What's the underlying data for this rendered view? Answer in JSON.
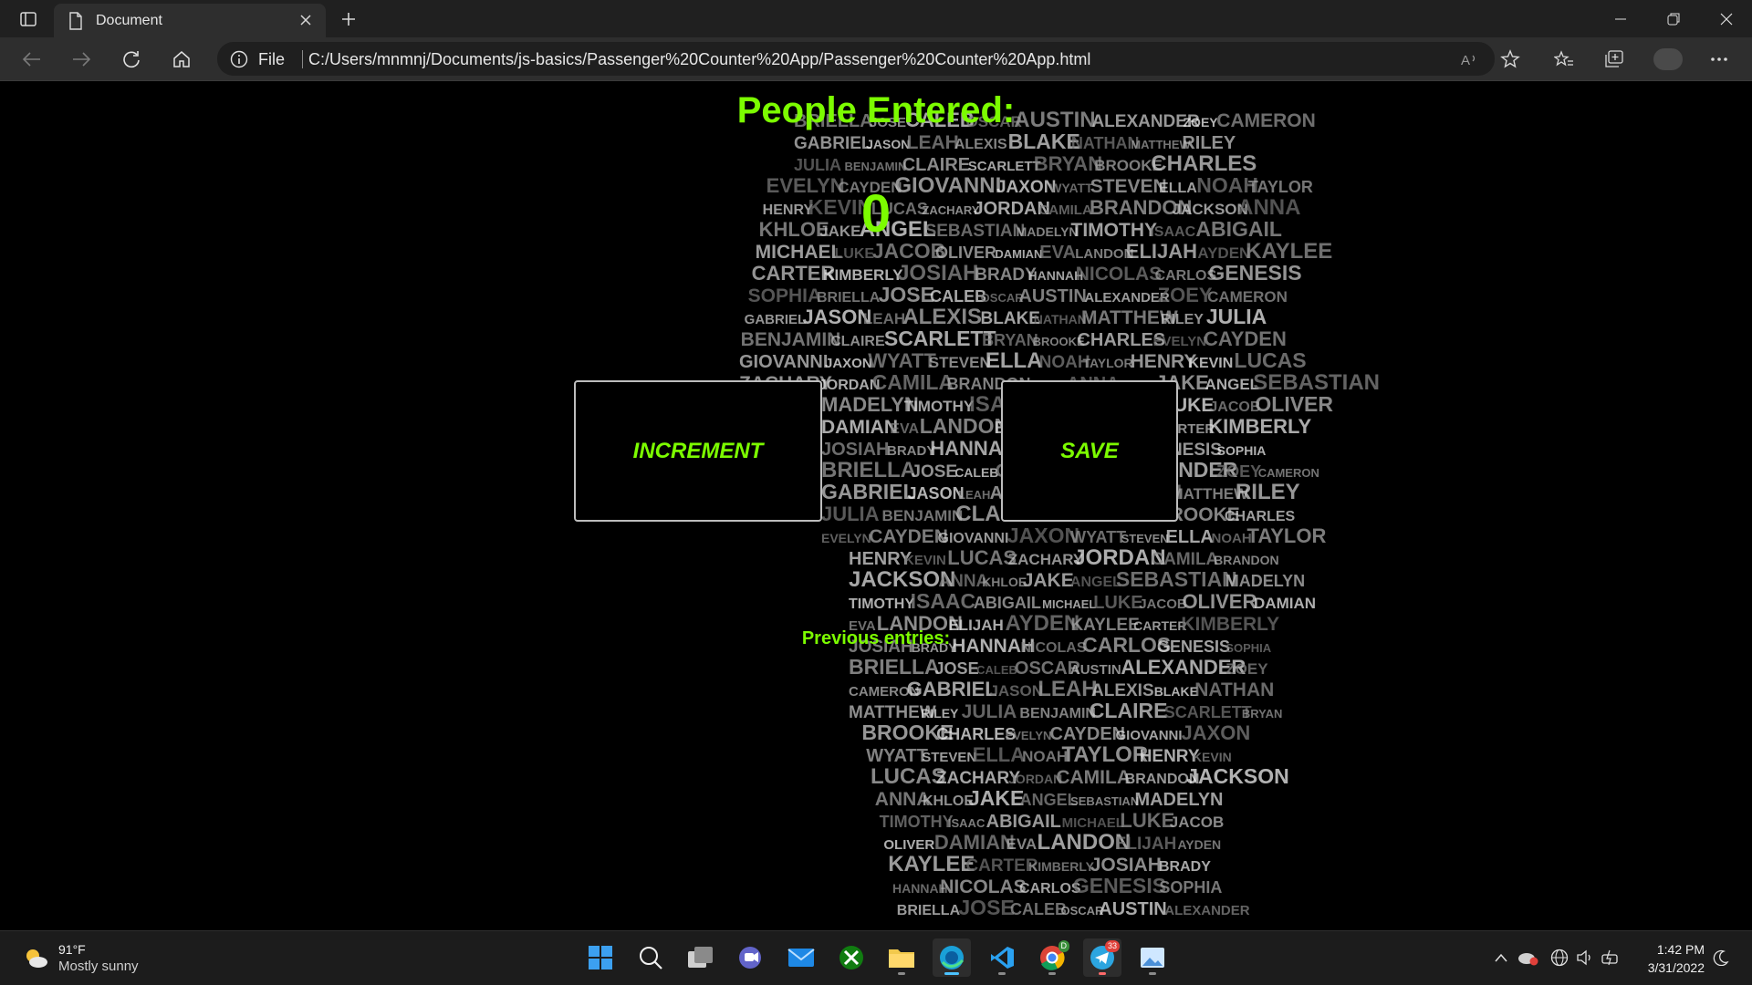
{
  "browser": {
    "tab_title": "Document",
    "address": {
      "scheme_label": "File",
      "url": "C:/Users/mnmnj/Documents/js-basics/Passenger%20Counter%20App/Passenger%20Counter%20App.html"
    }
  },
  "page": {
    "heading": "People Entered:",
    "count": "0",
    "increment_label": "INCREMENT",
    "save_label": "SAVE",
    "previous_label": "Previous entries:",
    "accent_color": "#7cfc00",
    "background_art_names": [
      "BRIELLA",
      "JOSE",
      "CALEB",
      "OSCAR",
      "AUSTIN",
      "ALEXANDER",
      "ZOEY",
      "CAMERON",
      "GABRIEL",
      "JASON",
      "LEAH",
      "ALEXIS",
      "BLAKE",
      "NATHAN",
      "MATTHEW",
      "RILEY",
      "JULIA",
      "BENJAMIN",
      "CLAIRE",
      "SCARLETT",
      "BRYAN",
      "BROOKE",
      "CHARLES",
      "EVELYN",
      "CAYDEN",
      "GIOVANNI",
      "JAXON",
      "WYATT",
      "STEVEN",
      "ELLA",
      "NOAH",
      "TAYLOR",
      "HENRY",
      "KEVIN",
      "LUCAS",
      "ZACHARY",
      "JORDAN",
      "CAMILA",
      "BRANDON",
      "JACKSON",
      "ANNA",
      "KHLOE",
      "JAKE",
      "ANGEL",
      "SEBASTIAN",
      "MADELYN",
      "TIMOTHY",
      "ISAAC",
      "ABIGAIL",
      "MICHAEL",
      "LUKE",
      "JACOB",
      "OLIVER",
      "DAMIAN",
      "EVA",
      "LANDON",
      "ELIJAH",
      "AYDEN",
      "KAYLEE",
      "CARTER",
      "KIMBERLY",
      "JOSIAH",
      "BRADY",
      "HANNAH",
      "NICOLAS",
      "CARLOS",
      "GENESIS",
      "SOPHIA"
    ]
  },
  "taskbar": {
    "weather_temp": "91°F",
    "weather_desc": "Mostly sunny",
    "telegram_badge": "33",
    "chrome_badge": "D",
    "time": "1:42 PM",
    "date": "3/31/2022"
  }
}
